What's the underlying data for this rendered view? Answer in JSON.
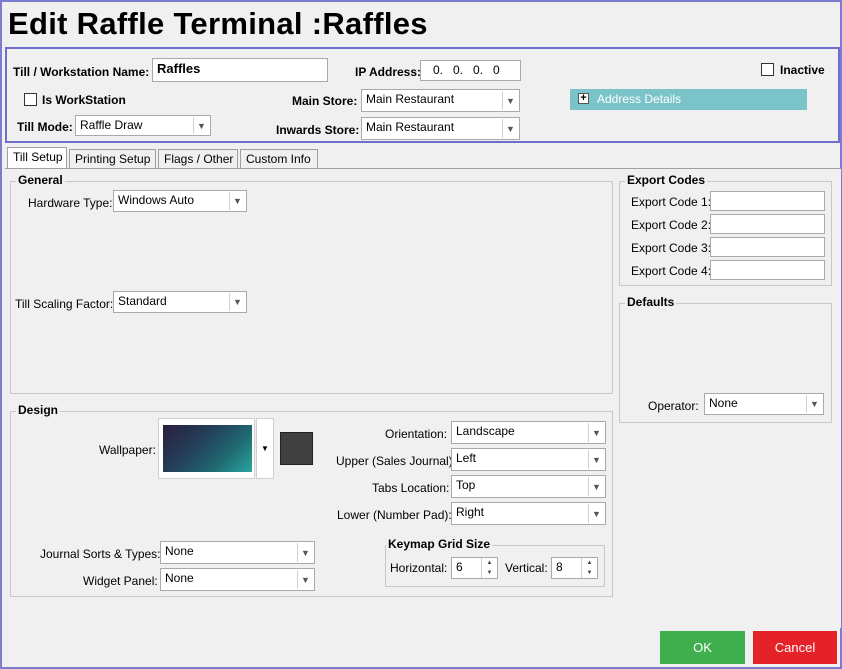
{
  "window": {
    "title": "Edit Raffle Terminal :Raffles"
  },
  "header": {
    "till_name_label": "Till / Workstation Name:",
    "till_name_value": "Raffles",
    "ip_label": "IP Address:",
    "ip_value": "0.   0.   0.   0",
    "inactive_label": "Inactive",
    "is_workstation_label": "Is WorkStation",
    "main_store_label": "Main Store:",
    "main_store_value": "Main Restaurant",
    "address_details_label": "Address Details",
    "till_mode_label": "Till Mode:",
    "till_mode_value": "Raffle Draw",
    "inwards_store_label": "Inwards Store:",
    "inwards_store_value": "Main Restaurant"
  },
  "tabs": [
    {
      "label": "Till Setup",
      "active": true
    },
    {
      "label": "Printing Setup",
      "active": false
    },
    {
      "label": "Flags / Other",
      "active": false
    },
    {
      "label": "Custom Info",
      "active": false
    }
  ],
  "general": {
    "title": "General",
    "hardware_type_label": "Hardware Type:",
    "hardware_type_value": "Windows Auto",
    "scaling_label": "Till Scaling Factor:",
    "scaling_value": "Standard"
  },
  "export_codes": {
    "title": "Export Codes",
    "labels": [
      "Export Code 1:",
      "Export Code 2:",
      "Export Code 3:",
      "Export Code 4:"
    ],
    "values": [
      "",
      "",
      "",
      ""
    ]
  },
  "defaults": {
    "title": "Defaults",
    "operator_label": "Operator:",
    "operator_value": "None"
  },
  "design": {
    "title": "Design",
    "wallpaper_label": "Wallpaper:",
    "orientation_label": "Orientation:",
    "orientation_value": "Landscape",
    "upper_label": "Upper (Sales Journal):",
    "upper_value": "Left",
    "tabs_location_label": "Tabs Location:",
    "tabs_location_value": "Top",
    "lower_label": "Lower (Number Pad):",
    "lower_value": "Right",
    "journal_sorts_label": "Journal Sorts & Types:",
    "journal_sorts_value": "None",
    "widget_panel_label": "Widget Panel:",
    "widget_panel_value": "None",
    "keymap_title": "Keymap Grid Size",
    "horizontal_label": "Horizontal:",
    "horizontal_value": "6",
    "vertical_label": "Vertical:",
    "vertical_value": "8"
  },
  "buttons": {
    "ok": "OK",
    "cancel": "Cancel"
  },
  "colors": {
    "border_accent": "#6e6ecc",
    "address_bar": "#79c3c9",
    "ok": "#3eaf4c",
    "cancel": "#e52228"
  }
}
